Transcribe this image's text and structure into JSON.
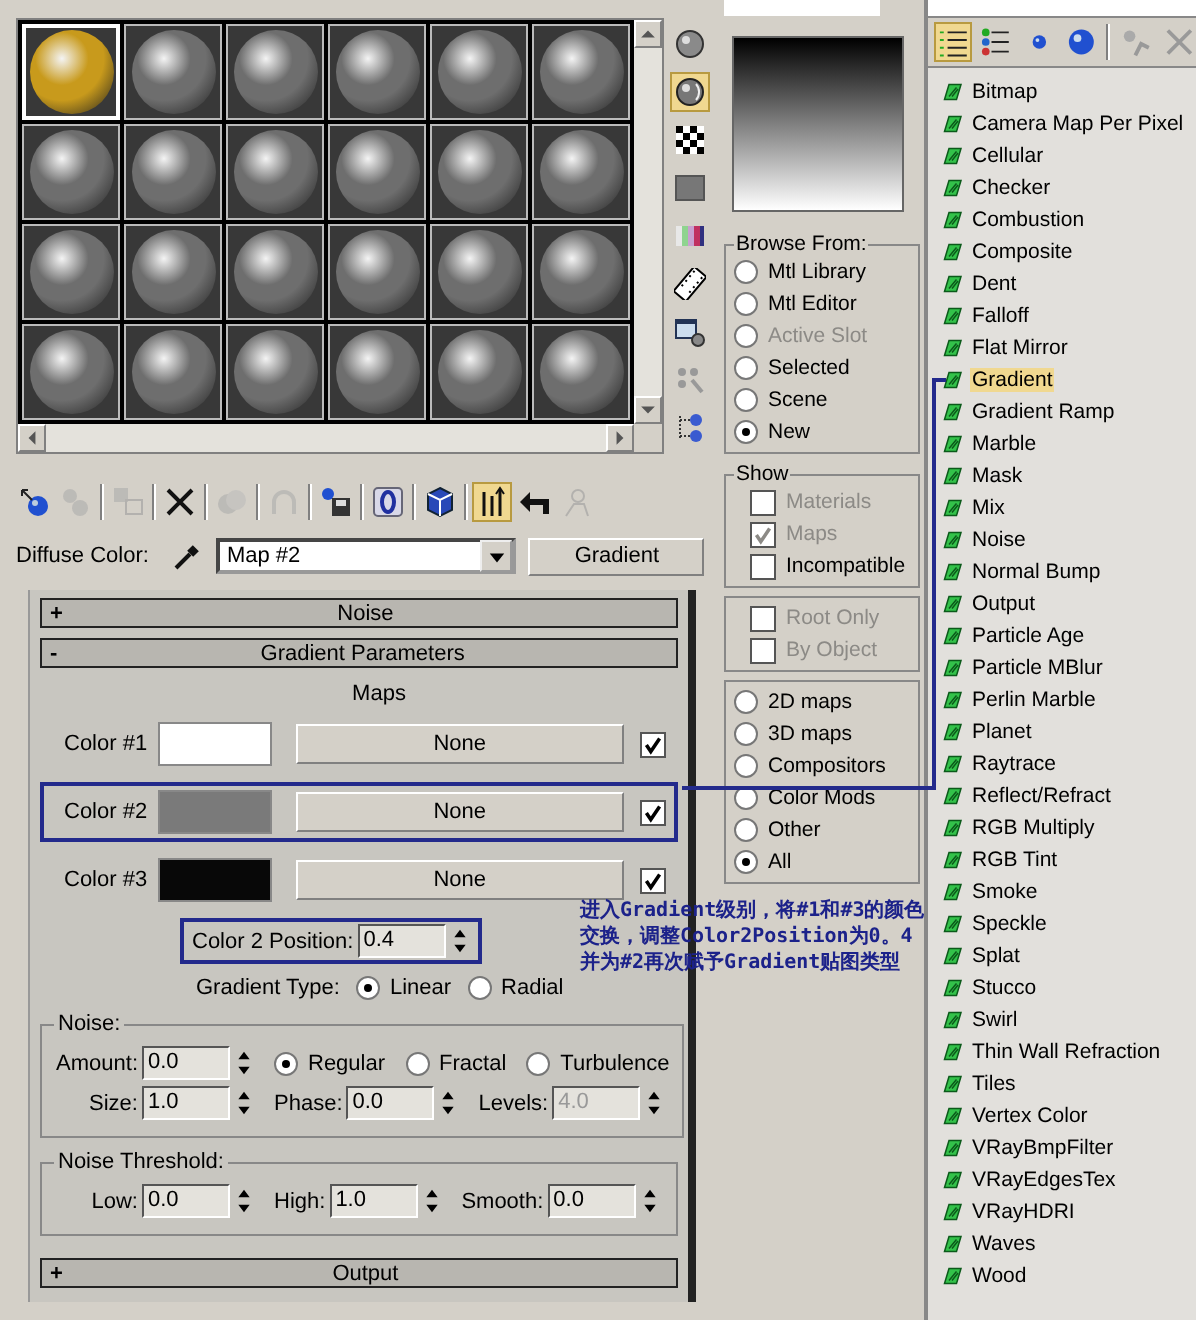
{
  "sample_slots": [
    {
      "selected": true,
      "color": "#c89a1c"
    },
    {
      "selected": false,
      "color": "#6e6e6e"
    },
    {
      "selected": false,
      "color": "#6e6e6e"
    },
    {
      "selected": false,
      "color": "#6e6e6e"
    },
    {
      "selected": false,
      "color": "#6e6e6e"
    },
    {
      "selected": false,
      "color": "#6e6e6e"
    },
    {
      "selected": false,
      "color": "#6e6e6e"
    },
    {
      "selected": false,
      "color": "#6e6e6e"
    },
    {
      "selected": false,
      "color": "#6e6e6e"
    },
    {
      "selected": false,
      "color": "#6e6e6e"
    },
    {
      "selected": false,
      "color": "#6e6e6e"
    },
    {
      "selected": false,
      "color": "#6e6e6e"
    },
    {
      "selected": false,
      "color": "#6e6e6e"
    },
    {
      "selected": false,
      "color": "#6e6e6e"
    },
    {
      "selected": false,
      "color": "#6e6e6e"
    },
    {
      "selected": false,
      "color": "#6e6e6e"
    },
    {
      "selected": false,
      "color": "#6e6e6e"
    },
    {
      "selected": false,
      "color": "#6e6e6e"
    },
    {
      "selected": false,
      "color": "#6e6e6e"
    },
    {
      "selected": false,
      "color": "#6e6e6e"
    },
    {
      "selected": false,
      "color": "#6e6e6e"
    },
    {
      "selected": false,
      "color": "#6e6e6e"
    },
    {
      "selected": false,
      "color": "#6e6e6e"
    },
    {
      "selected": false,
      "color": "#6e6e6e"
    }
  ],
  "side_toolbar": [
    {
      "kind": "sphere",
      "active": false
    },
    {
      "kind": "backlight",
      "active": true
    },
    {
      "kind": "checker",
      "active": false
    },
    {
      "kind": "swatch",
      "active": false
    },
    {
      "kind": "colorbars",
      "active": false
    },
    {
      "kind": "film",
      "active": false
    },
    {
      "kind": "window",
      "active": false
    },
    {
      "kind": "dots",
      "active": false
    },
    {
      "kind": "nodes",
      "active": false
    }
  ],
  "bottom_toolbar": [
    [
      {
        "kind": "get",
        "active": false,
        "disabled": false
      },
      {
        "kind": "put",
        "active": false,
        "disabled": true
      }
    ],
    [
      {
        "kind": "assign",
        "active": false,
        "disabled": true
      }
    ],
    [
      {
        "kind": "delete",
        "active": false,
        "disabled": false
      }
    ],
    [
      {
        "kind": "copy",
        "active": false,
        "disabled": true
      }
    ],
    [
      {
        "kind": "unique",
        "active": false,
        "disabled": true
      }
    ],
    [
      {
        "kind": "library",
        "active": false,
        "disabled": false
      }
    ],
    [
      {
        "kind": "effects",
        "active": false,
        "disabled": false
      }
    ],
    [
      {
        "kind": "cube",
        "active": false,
        "disabled": false
      }
    ],
    [
      {
        "kind": "result",
        "active": true,
        "disabled": false
      },
      {
        "kind": "parent",
        "active": false,
        "disabled": false
      },
      {
        "kind": "sibling",
        "active": false,
        "disabled": true
      }
    ]
  ],
  "diffuse": {
    "label": "Diffuse Color:",
    "map_name": "Map #2",
    "map_type": "Gradient"
  },
  "noise_rollout": {
    "sign": "+",
    "title": "Noise"
  },
  "gradient_rollout": {
    "sign": "-",
    "title": "Gradient Parameters"
  },
  "gradient_parameters": {
    "maps_label": "Maps",
    "colors": [
      {
        "label": "Color #1",
        "color": "#ffffff",
        "map": "None",
        "checked": true,
        "highlighted": false
      },
      {
        "label": "Color #2",
        "color": "#7a7a7a",
        "map": "None",
        "checked": true,
        "highlighted": true
      },
      {
        "label": "Color #3",
        "color": "#080808",
        "map": "None",
        "checked": true,
        "highlighted": false
      }
    ],
    "color2_position": {
      "label": "Color 2 Position:",
      "value": "0.4",
      "highlighted": true
    },
    "gradient_type": {
      "label": "Gradient Type:",
      "options": [
        {
          "label": "Linear",
          "selected": true
        },
        {
          "label": "Radial",
          "selected": false
        }
      ]
    },
    "noise": {
      "title": "Noise:",
      "amount": {
        "label": "Amount:",
        "value": "0.0",
        "disabled": false
      },
      "types": [
        {
          "label": "Regular",
          "selected": true
        },
        {
          "label": "Fractal",
          "selected": false
        },
        {
          "label": "Turbulence",
          "selected": false
        }
      ],
      "fields": [
        {
          "label": "Size:",
          "value": "1.0",
          "disabled": false
        },
        {
          "label": "Phase:",
          "value": "0.0",
          "disabled": false
        },
        {
          "label": "Levels:",
          "value": "4.0",
          "disabled": true
        }
      ]
    },
    "noise_threshold": {
      "title": "Noise Threshold:",
      "fields": [
        {
          "label": "Low:",
          "value": "0.0",
          "disabled": false
        },
        {
          "label": "High:",
          "value": "1.0",
          "disabled": false
        },
        {
          "label": "Smooth:",
          "value": "0.0",
          "disabled": false
        }
      ]
    }
  },
  "output_rollout": {
    "sign": "+",
    "title": "Output"
  },
  "browser": {
    "browse_from": {
      "title": "Browse From:",
      "options": [
        {
          "label": "Mtl Library",
          "selected": false,
          "disabled": false
        },
        {
          "label": "Mtl Editor",
          "selected": false,
          "disabled": false
        },
        {
          "label": "Active Slot",
          "selected": false,
          "disabled": true
        },
        {
          "label": "Selected",
          "selected": false,
          "disabled": false
        },
        {
          "label": "Scene",
          "selected": false,
          "disabled": false
        },
        {
          "label": "New",
          "selected": true,
          "disabled": false
        }
      ]
    },
    "show": {
      "title": "Show",
      "options": [
        {
          "label": "Materials",
          "checked": false,
          "disabled": true
        },
        {
          "label": "Maps",
          "checked": true,
          "disabled": true
        },
        {
          "label": "Incompatible",
          "checked": false,
          "disabled": false
        }
      ]
    },
    "filters": [
      {
        "label": "Root Only",
        "checked": false,
        "disabled": true
      },
      {
        "label": "By Object",
        "checked": false,
        "disabled": true
      }
    ],
    "categories": [
      {
        "label": "2D maps",
        "selected": false
      },
      {
        "label": "3D maps",
        "selected": false
      },
      {
        "label": "Compositors",
        "selected": false
      },
      {
        "label": "Color Mods",
        "selected": false
      },
      {
        "label": "Other",
        "selected": false
      },
      {
        "label": "All",
        "selected": true
      }
    ],
    "toolbar": [
      [
        {
          "kind": "list",
          "active": true
        },
        {
          "kind": "listicons",
          "active": false
        },
        {
          "kind": "smallsphere",
          "active": false
        },
        {
          "kind": "largesphere",
          "active": false
        }
      ],
      [
        {
          "kind": "update",
          "active": false
        },
        {
          "kind": "xgrey",
          "active": false
        }
      ]
    ],
    "map_types": [
      {
        "label": "Bitmap",
        "selected": false
      },
      {
        "label": "Camera Map Per Pixel",
        "selected": false
      },
      {
        "label": "Cellular",
        "selected": false
      },
      {
        "label": "Checker",
        "selected": false
      },
      {
        "label": "Combustion",
        "selected": false
      },
      {
        "label": "Composite",
        "selected": false
      },
      {
        "label": "Dent",
        "selected": false
      },
      {
        "label": "Falloff",
        "selected": false
      },
      {
        "label": "Flat Mirror",
        "selected": false
      },
      {
        "label": "Gradient",
        "selected": true
      },
      {
        "label": "Gradient Ramp",
        "selected": false
      },
      {
        "label": "Marble",
        "selected": false
      },
      {
        "label": "Mask",
        "selected": false
      },
      {
        "label": "Mix",
        "selected": false
      },
      {
        "label": "Noise",
        "selected": false
      },
      {
        "label": "Normal Bump",
        "selected": false
      },
      {
        "label": "Output",
        "selected": false
      },
      {
        "label": "Particle Age",
        "selected": false
      },
      {
        "label": "Particle MBlur",
        "selected": false
      },
      {
        "label": "Perlin Marble",
        "selected": false
      },
      {
        "label": "Planet",
        "selected": false
      },
      {
        "label": "Raytrace",
        "selected": false
      },
      {
        "label": "Reflect/Refract",
        "selected": false
      },
      {
        "label": "RGB Multiply",
        "selected": false
      },
      {
        "label": "RGB Tint",
        "selected": false
      },
      {
        "label": "Smoke",
        "selected": false
      },
      {
        "label": "Speckle",
        "selected": false
      },
      {
        "label": "Splat",
        "selected": false
      },
      {
        "label": "Stucco",
        "selected": false
      },
      {
        "label": "Swirl",
        "selected": false
      },
      {
        "label": "Thin Wall Refraction",
        "selected": false
      },
      {
        "label": "Tiles",
        "selected": false
      },
      {
        "label": "Vertex Color",
        "selected": false
      },
      {
        "label": "VRayBmpFilter",
        "selected": false
      },
      {
        "label": "VRayEdgesTex",
        "selected": false
      },
      {
        "label": "VRayHDRI",
        "selected": false
      },
      {
        "label": "Waves",
        "selected": false
      },
      {
        "label": "Wood",
        "selected": false
      }
    ]
  },
  "annotation": {
    "lines": [
      "进入Gradient级别，将#1和#3的颜色交换，调整Color2Position为0。4",
      "并为#2再次赋予Gradient贴图类型"
    ]
  }
}
